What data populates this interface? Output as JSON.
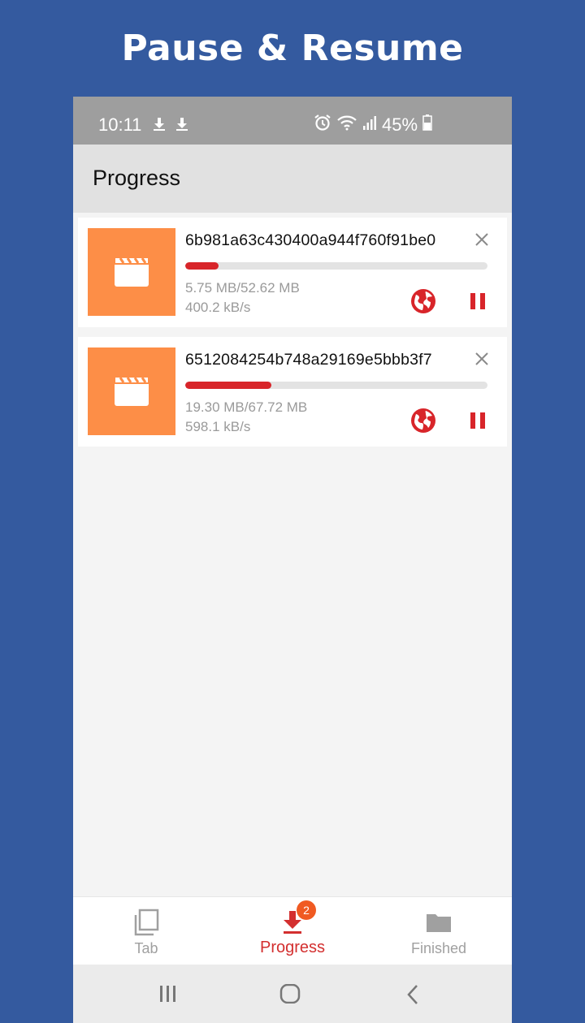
{
  "banner": {
    "title": "Pause & Resume"
  },
  "status_bar": {
    "time": "10:11",
    "battery": "45%",
    "icons": [
      "download-icon",
      "download-icon",
      "alarm-icon",
      "wifi-icon",
      "signal-icon",
      "battery-icon"
    ]
  },
  "app_bar": {
    "title": "Progress"
  },
  "downloads": [
    {
      "name": "6b981a63c430400a944f760f91be0",
      "size": "5.75 MB/52.62 MB",
      "speed": "400.2 kB/s",
      "progress": 0.109
    },
    {
      "name": "6512084254b748a29169e5bbb3f7",
      "size": "19.30 MB/67.72 MB",
      "speed": "598.1 kB/s",
      "progress": 0.285
    }
  ],
  "bottom_nav": {
    "tab_label": "Tab",
    "progress_label": "Progress",
    "progress_badge": "2",
    "finished_label": "Finished"
  },
  "colors": {
    "accent": "#d8252a",
    "thumbnail": "#fd8e47",
    "background": "#345a9f"
  }
}
